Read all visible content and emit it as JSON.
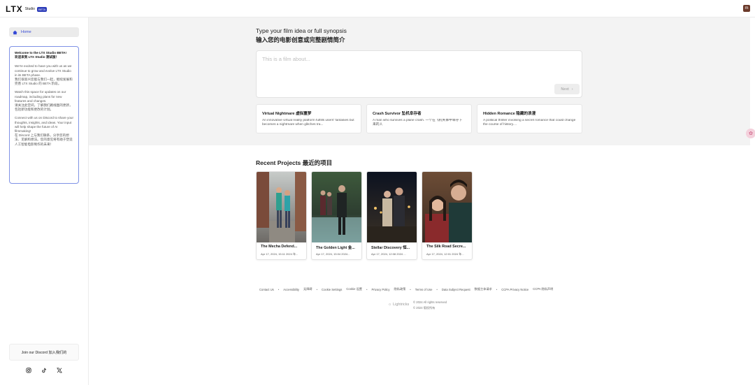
{
  "header": {
    "logo_text": "LTX",
    "logo_studio": "Studio",
    "logo_badge": "BETA",
    "avatar_initial": "m"
  },
  "sidebar": {
    "home_label": "Home",
    "welcome": {
      "title": "Welcome to the LTX Studio BETA!",
      "title_cn": "欢迎来到 LTX Studio 测试版！",
      "p1": "We're excited to have you with us as we continue to grow and evolve LTX Studio in its BETA phase.",
      "p1_cn": "我们很高兴您能与我们一起，继续发展和完善 LTX Studio 的 BETA 阶段。",
      "p2": "Watch this space for updates on our roadmap, including plans for new features and changes.",
      "p2_cn": "请关注此空间，了解我们路线图的更新，包括新功能和更改的计划。",
      "p3": "Connect with us on Discord to share your thoughts, insights, and ideas. Your input will help shape the future of AI filmmaking!",
      "p3_cn": "在 Discord 上与我们联系，分享您的想法、见解和想法。您的意见将有助于塑造人工智能电影制作的未来！"
    },
    "discord_label": "Join our Discord 加入我们的",
    "socials": [
      "instagram-icon",
      "tiktok-icon",
      "x-icon"
    ]
  },
  "main": {
    "prompt_title": "Type your film idea or full synopsis",
    "prompt_title_cn": "输入您的电影创意或完整剧情简介",
    "prompt_placeholder": "This is a film about...",
    "next_label": "Next",
    "ideas": [
      {
        "title": "Virtual Nightmare 虚拟噩梦",
        "desc": "An innovative virtual reality platform fulfills users' fantasies but becomes a nightmare when glitches tra..."
      },
      {
        "title": "Crash Survivor 坠机幸存者",
        "desc": "A man who survives a plane crash. 一个在飞机失事中幸存下来的人"
      },
      {
        "title": "Hidden Romance 隐藏的浪漫",
        "desc": "A political thriller involving a secret romance that could change the course of history...."
      }
    ],
    "recent_title": "Recent Projects 最近的项目",
    "projects": [
      {
        "title": "The Mecha Defend...",
        "date": "Apr 17, 2024, 15:11 2024 年..."
      },
      {
        "title": "The Golden Light 金...",
        "date": "Apr 17, 2024, 15:04 2024..."
      },
      {
        "title": "Stellar Discovery 恒...",
        "date": "Apr 17, 2024, 12:08 2024 ..."
      },
      {
        "title": "The Silk Road Secre...",
        "date": "Apr 17, 2024, 12:01 2024 年..."
      }
    ]
  },
  "footer": {
    "links": [
      "Contact Us",
      "Accessibility",
      "无障碍",
      "Cookie Settings",
      "Cookie 设置",
      "Privacy Policy",
      "隐私政策",
      "Terms of Use",
      "Data Subject Request",
      "数据主体请求",
      "CCPA Privacy Notice",
      "CCPA 隐私声明"
    ],
    "brand": "Lightricks",
    "copyright": "© 2024 All rights reserved",
    "copyright_cn": "© 2024 版权所有"
  },
  "colors": {
    "accent": "#3448d6",
    "welcome_border": "#7f92e6",
    "hero_bg": "#f3f3f3"
  }
}
